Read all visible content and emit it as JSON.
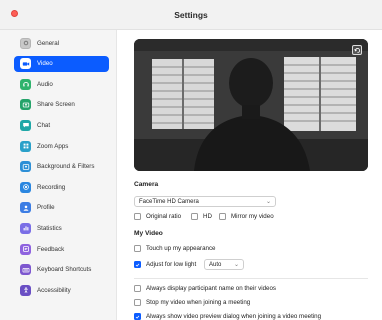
{
  "window": {
    "title": "Settings"
  },
  "sidebar": {
    "items": [
      {
        "label": "General",
        "icon": "gear-icon",
        "color": "#c8c8c8",
        "active": false
      },
      {
        "label": "Video",
        "icon": "video-camera-icon",
        "color": "#ffffff",
        "active": true
      },
      {
        "label": "Audio",
        "icon": "headphones-icon",
        "color": "#2fb36d",
        "active": false
      },
      {
        "label": "Share Screen",
        "icon": "share-screen-icon",
        "color": "#25a36a",
        "active": false
      },
      {
        "label": "Chat",
        "icon": "chat-bubble-icon",
        "color": "#1fa7a7",
        "active": false
      },
      {
        "label": "Zoom Apps",
        "icon": "apps-icon",
        "color": "#2aa0c9",
        "active": false
      },
      {
        "label": "Background & Filters",
        "icon": "background-filters-icon",
        "color": "#2d8fd6",
        "active": false
      },
      {
        "label": "Recording",
        "icon": "recording-icon",
        "color": "#2a86e0",
        "active": false
      },
      {
        "label": "Profile",
        "icon": "profile-icon",
        "color": "#3c7de4",
        "active": false
      },
      {
        "label": "Statistics",
        "icon": "statistics-icon",
        "color": "#7a6ee6",
        "active": false
      },
      {
        "label": "Feedback",
        "icon": "feedback-icon",
        "color": "#8e62df",
        "active": false
      },
      {
        "label": "Keyboard Shortcuts",
        "icon": "keyboard-icon",
        "color": "#7d57cf",
        "active": false
      },
      {
        "label": "Accessibility",
        "icon": "accessibility-icon",
        "color": "#6a4fc4",
        "active": false
      }
    ]
  },
  "camera": {
    "heading": "Camera",
    "selected": "FaceTime HD Camera",
    "options": [
      {
        "label": "Original ratio",
        "checked": false
      },
      {
        "label": "HD",
        "checked": false
      },
      {
        "label": "Mirror my video",
        "checked": false
      }
    ]
  },
  "my_video": {
    "heading": "My Video",
    "touch_up": {
      "label": "Touch up my appearance",
      "checked": false
    },
    "low_light": {
      "label": "Adjust for low light",
      "checked": true,
      "value": "Auto"
    }
  },
  "meeting_options": [
    {
      "label": "Always display participant name on their videos",
      "checked": false
    },
    {
      "label": "Stop my video when joining a meeting",
      "checked": false
    },
    {
      "label": "Always show video preview dialog when joining a video meeting",
      "checked": true
    }
  ],
  "colors": {
    "accent": "#0b5cff",
    "close": "#fe5f57"
  }
}
